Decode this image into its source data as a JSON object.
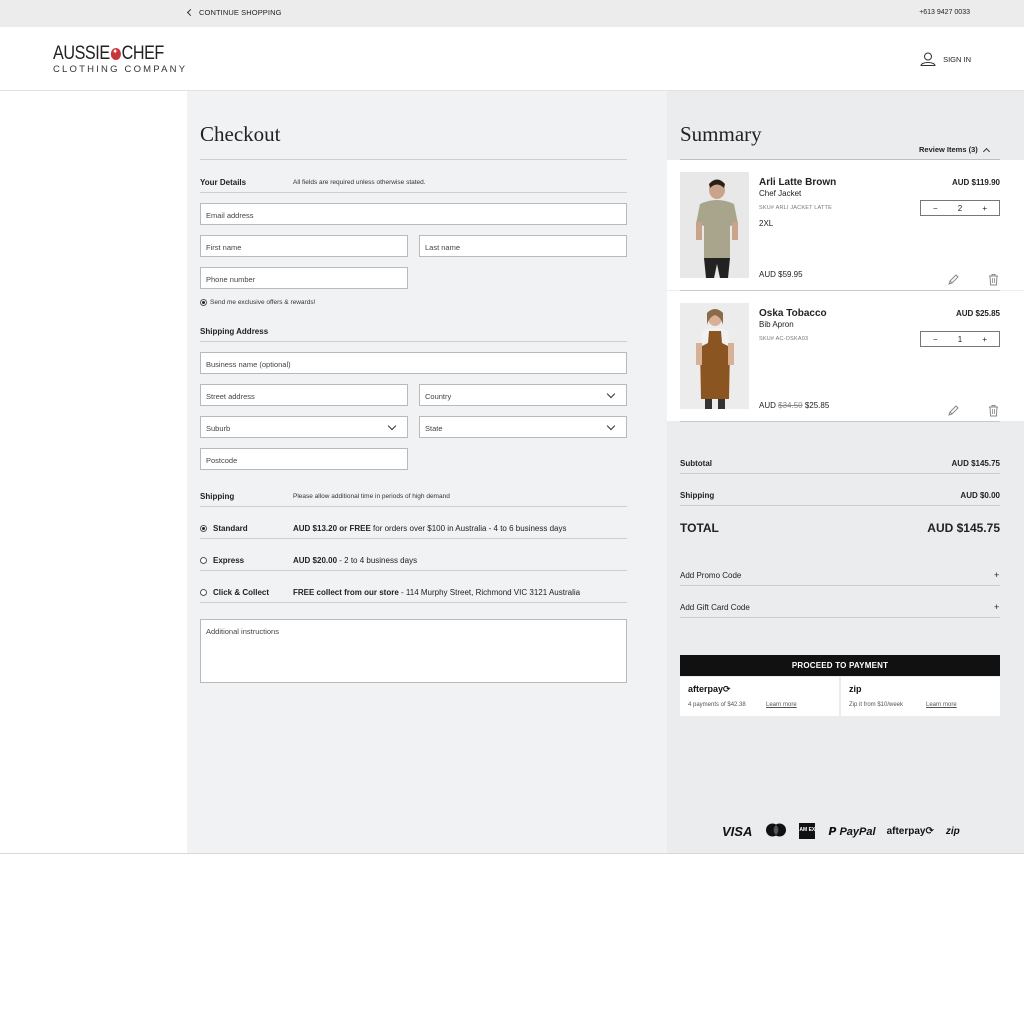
{
  "topbar": {
    "continue_label": "CONTINUE SHOPPING",
    "phone": "+613 9427 0033"
  },
  "header": {
    "logo_line1_a": "AUSSIE",
    "logo_line1_b": "CHEF",
    "logo_line2": "CLOTHING COMPANY",
    "signin_label": "SIGN IN"
  },
  "checkout": {
    "title": "Checkout",
    "details_label": "Your Details",
    "details_note": "All fields are required unless otherwise stated.",
    "email_placeholder": "Email address",
    "first_name_placeholder": "First name",
    "last_name_placeholder": "Last name",
    "phone_placeholder": "Phone number",
    "offers_label": "Send me exclusive offers & rewards!",
    "shipping_address_label": "Shipping Address",
    "business_placeholder": "Business name (optional)",
    "street_placeholder": "Street address",
    "country_placeholder": "Country",
    "suburb_placeholder": "Suburb",
    "state_placeholder": "State",
    "postcode_placeholder": "Postcode",
    "shipping_label": "Shipping",
    "shipping_note": "Please allow additional time in periods of high demand",
    "options": [
      {
        "label": "Standard",
        "price": "AUD $13.20 or FREE",
        "desc": " for orders over $100 in Australia - 4 to 6 business days",
        "selected": true
      },
      {
        "label": "Express",
        "price": "AUD $20.00",
        "desc": " - 2 to 4 business days",
        "selected": false
      },
      {
        "label": "Click & Collect",
        "price": "FREE collect from our store",
        "desc": " - 114 Murphy Street, Richmond VIC 3121 Australia",
        "selected": false
      }
    ],
    "instructions_placeholder": "Additional instructions"
  },
  "summary": {
    "title": "Summary",
    "review_label": "Review Items (3)",
    "items": [
      {
        "name": "Arli Latte Brown",
        "type": "Chef Jacket",
        "sku": "SKU# ARLI JACKET LATTE",
        "size": "2XL",
        "unit_price": "AUD $59.95",
        "total": "AUD $119.90",
        "qty": "2"
      },
      {
        "name": "Oska Tobacco",
        "type": "Bib Apron",
        "sku": "SKU# AC-OSKA03",
        "unit_prefix": "AUD",
        "unit_old": "$34.50",
        "unit_new": "$25.85",
        "total": "AUD $25.85",
        "qty": "1"
      }
    ],
    "subtotal_label": "Subtotal",
    "subtotal_value": "AUD $145.75",
    "shipping_label": "Shipping",
    "shipping_value": "AUD $0.00",
    "total_label": "TOTAL",
    "total_value": "AUD $145.75",
    "promo_label": "Add Promo Code",
    "gift_label": "Add Gift Card Code",
    "proceed_label": "PROCEED TO PAYMENT",
    "afterpay": {
      "logo": "afterpay⟳",
      "sub": "4 payments of $42.38",
      "link": "Learn more"
    },
    "zip": {
      "logo": "zip",
      "sub": "Zip it from $10/week",
      "link": "Learn more"
    }
  },
  "footer_payments": {
    "visa": "VISA",
    "paypal": "PayPal",
    "afterpay": "afterpay⟳",
    "zip": "zip",
    "amex": "AM EX"
  }
}
